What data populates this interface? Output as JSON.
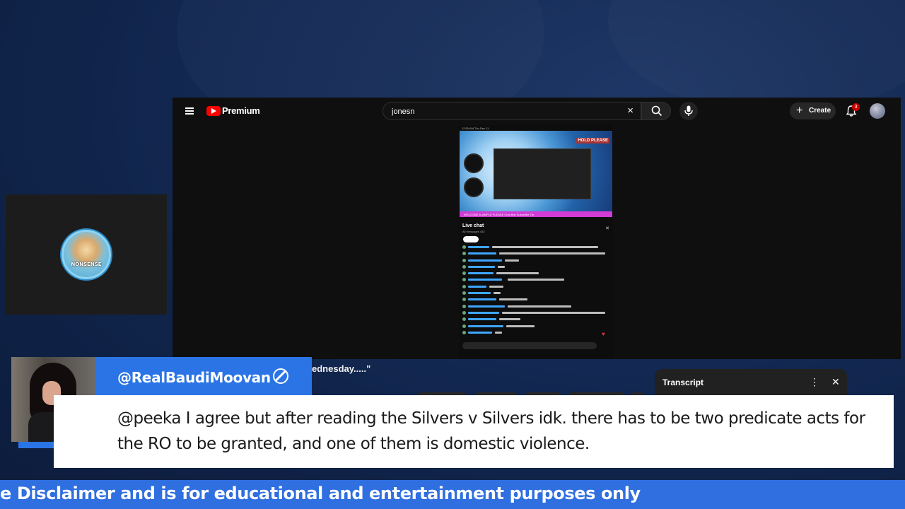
{
  "youtube": {
    "brand": "Premium",
    "search": {
      "value": "jonesn",
      "clear_icon": "×"
    },
    "create_label": "Create",
    "notification_count": "3",
    "video_title_partial": "ednesday.....\"",
    "transcript": {
      "title": "Transcript",
      "more_icon": "⋮",
      "close_icon": "✕"
    }
  },
  "inner_video": {
    "status_left": "12:55 AM   Thu Dec 11",
    "hold_label": "HOLD PLEASE",
    "ticker": "WELCOME to AMPLE PLEASE  Chat that  Subscribe  Tip",
    "chat_title": "Live chat",
    "chat_subtitle": "All messages  432",
    "close_icon": "✕",
    "heart_icon": "♥"
  },
  "overlay": {
    "author": "@RealBaudiMoovan",
    "message": "@peeka I agree but after reading the Silvers v Silvers idk. there has to be two predicate acts for the RO to be granted, and one of them is domestic violence.",
    "ticker": "e Disclaimer and is for educational and entertainment purposes only"
  },
  "colors": {
    "accent_blue": "#2a74e6",
    "ticker_blue": "#2f6fe0",
    "youtube_red": "#ff0000",
    "background_navy": "#142a55"
  },
  "icons": [
    "menu-icon",
    "youtube-logo-icon",
    "search-icon",
    "mic-icon",
    "plus-icon",
    "bell-icon",
    "ban-icon",
    "youtube-play-icon"
  ]
}
